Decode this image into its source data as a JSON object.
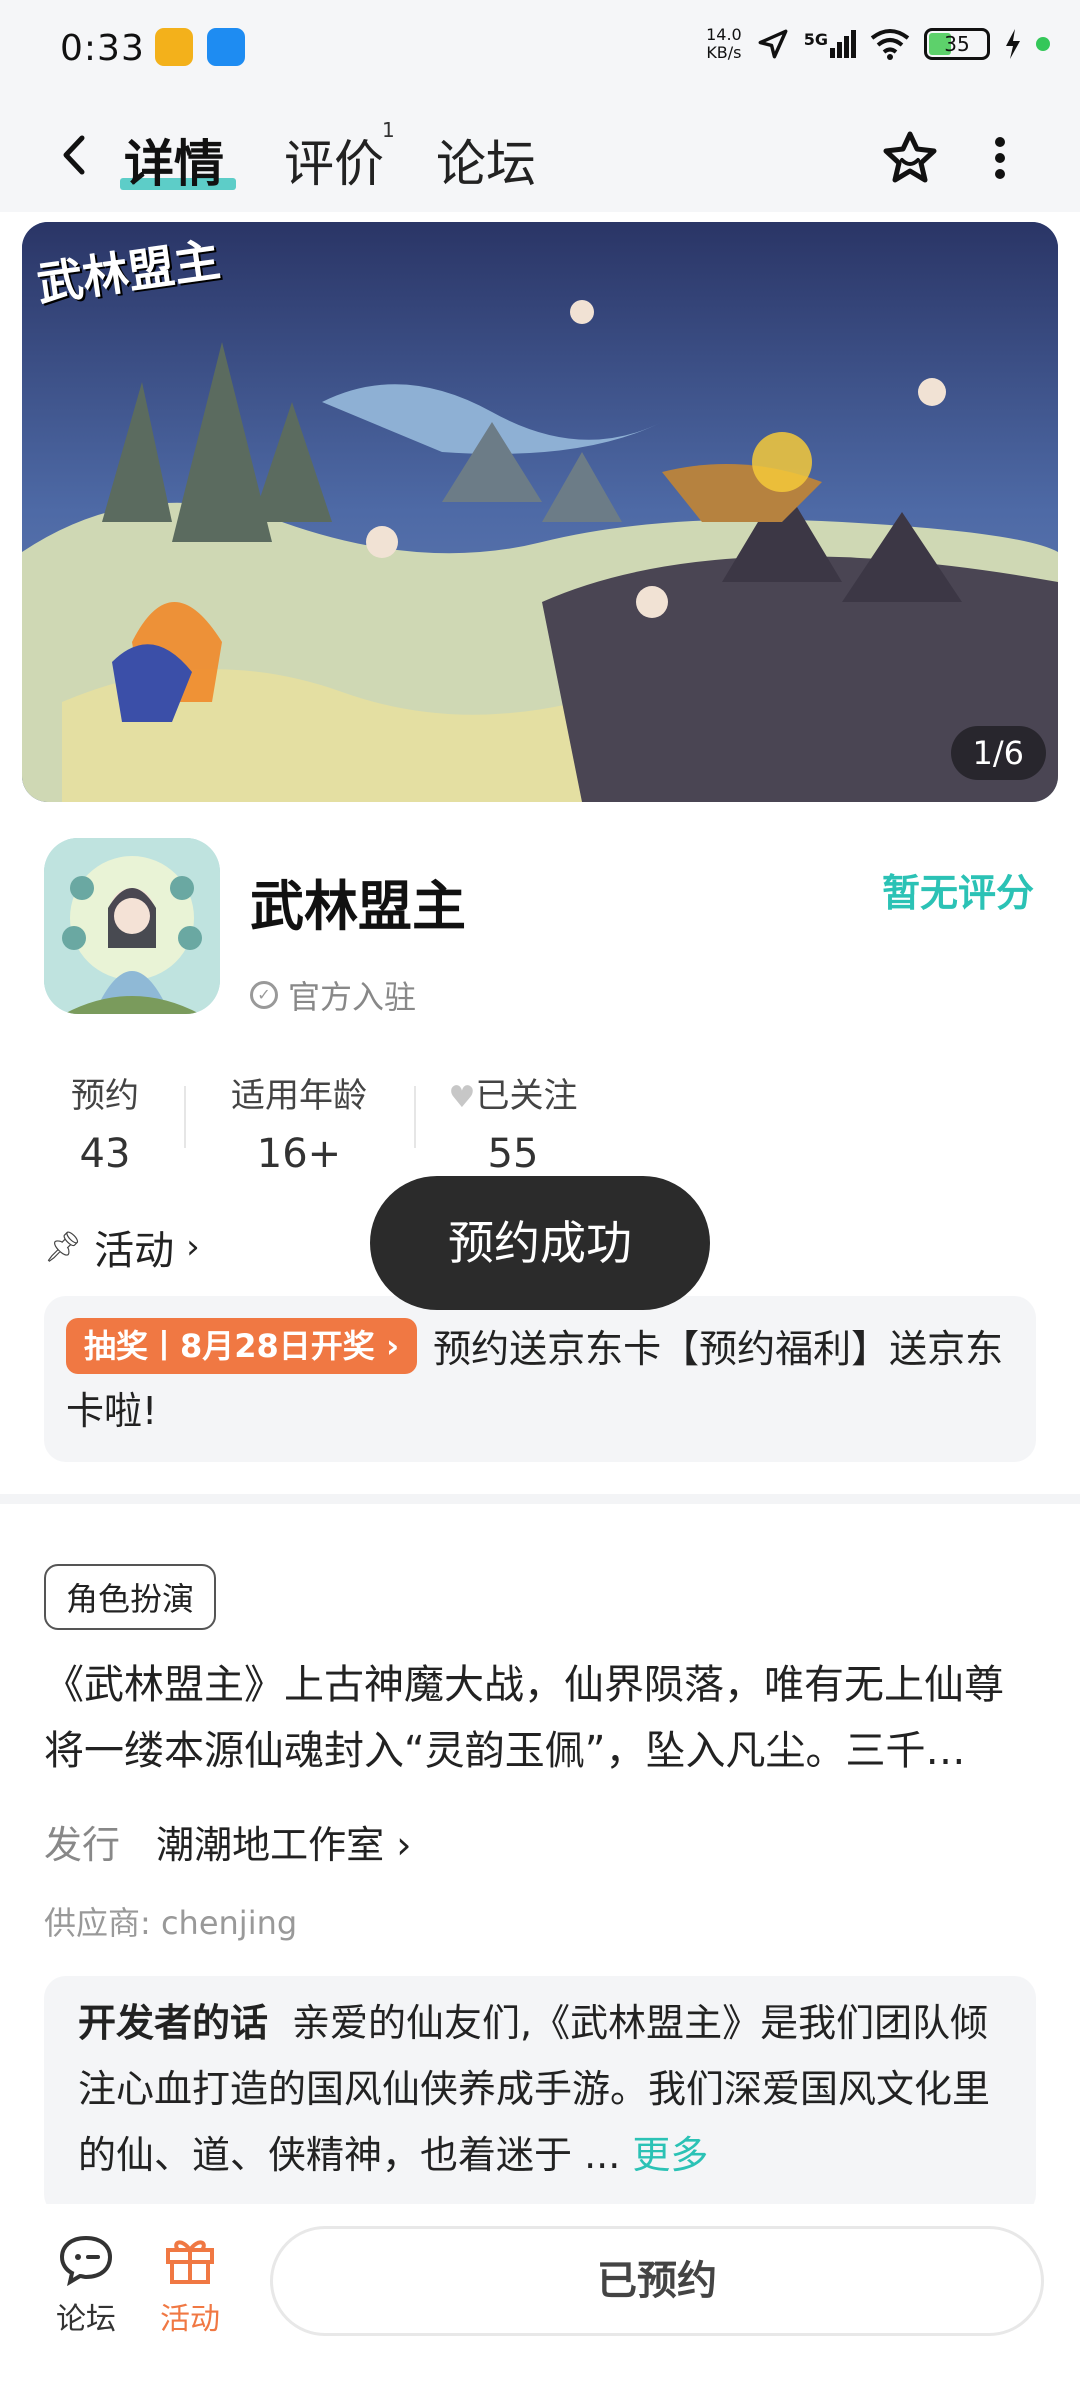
{
  "status_bar": {
    "time": "0:33",
    "net_speed_value": "14.0",
    "net_speed_unit": "KB/s",
    "network": "5G",
    "battery": "35"
  },
  "nav": {
    "tabs": [
      {
        "label": "详情",
        "active": true
      },
      {
        "label": "评价",
        "badge": "1"
      },
      {
        "label": "论坛"
      }
    ]
  },
  "banner": {
    "logo_text": "武林盟主",
    "pager": "1/6"
  },
  "app": {
    "title": "武林盟主",
    "official": "官方入驻",
    "rating": "暂无评分"
  },
  "stats": [
    {
      "label": "预约",
      "value": "43"
    },
    {
      "label": "适用年龄",
      "value": "16+"
    },
    {
      "label": "已关注",
      "value": "55"
    }
  ],
  "activity": {
    "title": "活动",
    "tag": "抽奖丨8月28日开奖",
    "text": "预约送京东卡【预约福利】送京东卡啦!"
  },
  "toast": "预约成功",
  "details": {
    "genre": "角色扮演",
    "description": "《武林盟主》上古神魔大战，仙界陨落，唯有无上仙尊将一缕本源仙魂封入“灵韵玉佩”，坠入凡尘。三千…",
    "publisher_label": "发行",
    "publisher": "潮潮地工作室",
    "supplier": "供应商: chenjing"
  },
  "developer": {
    "label": "开发者的话",
    "text": "亲爱的仙友们,《武林盟主》是我们团队倾注心血打造的国风仙侠养成手游。我们深爱国风文化里的仙、道、侠精神，也着迷于 ...",
    "more": "更多"
  },
  "bottom_bar": {
    "forum": "论坛",
    "activity": "活动",
    "reserved": "已预约"
  },
  "colors": {
    "accent": "#2bc2b5",
    "orange": "#f07843",
    "toast_bg": "#2b2b2b"
  }
}
